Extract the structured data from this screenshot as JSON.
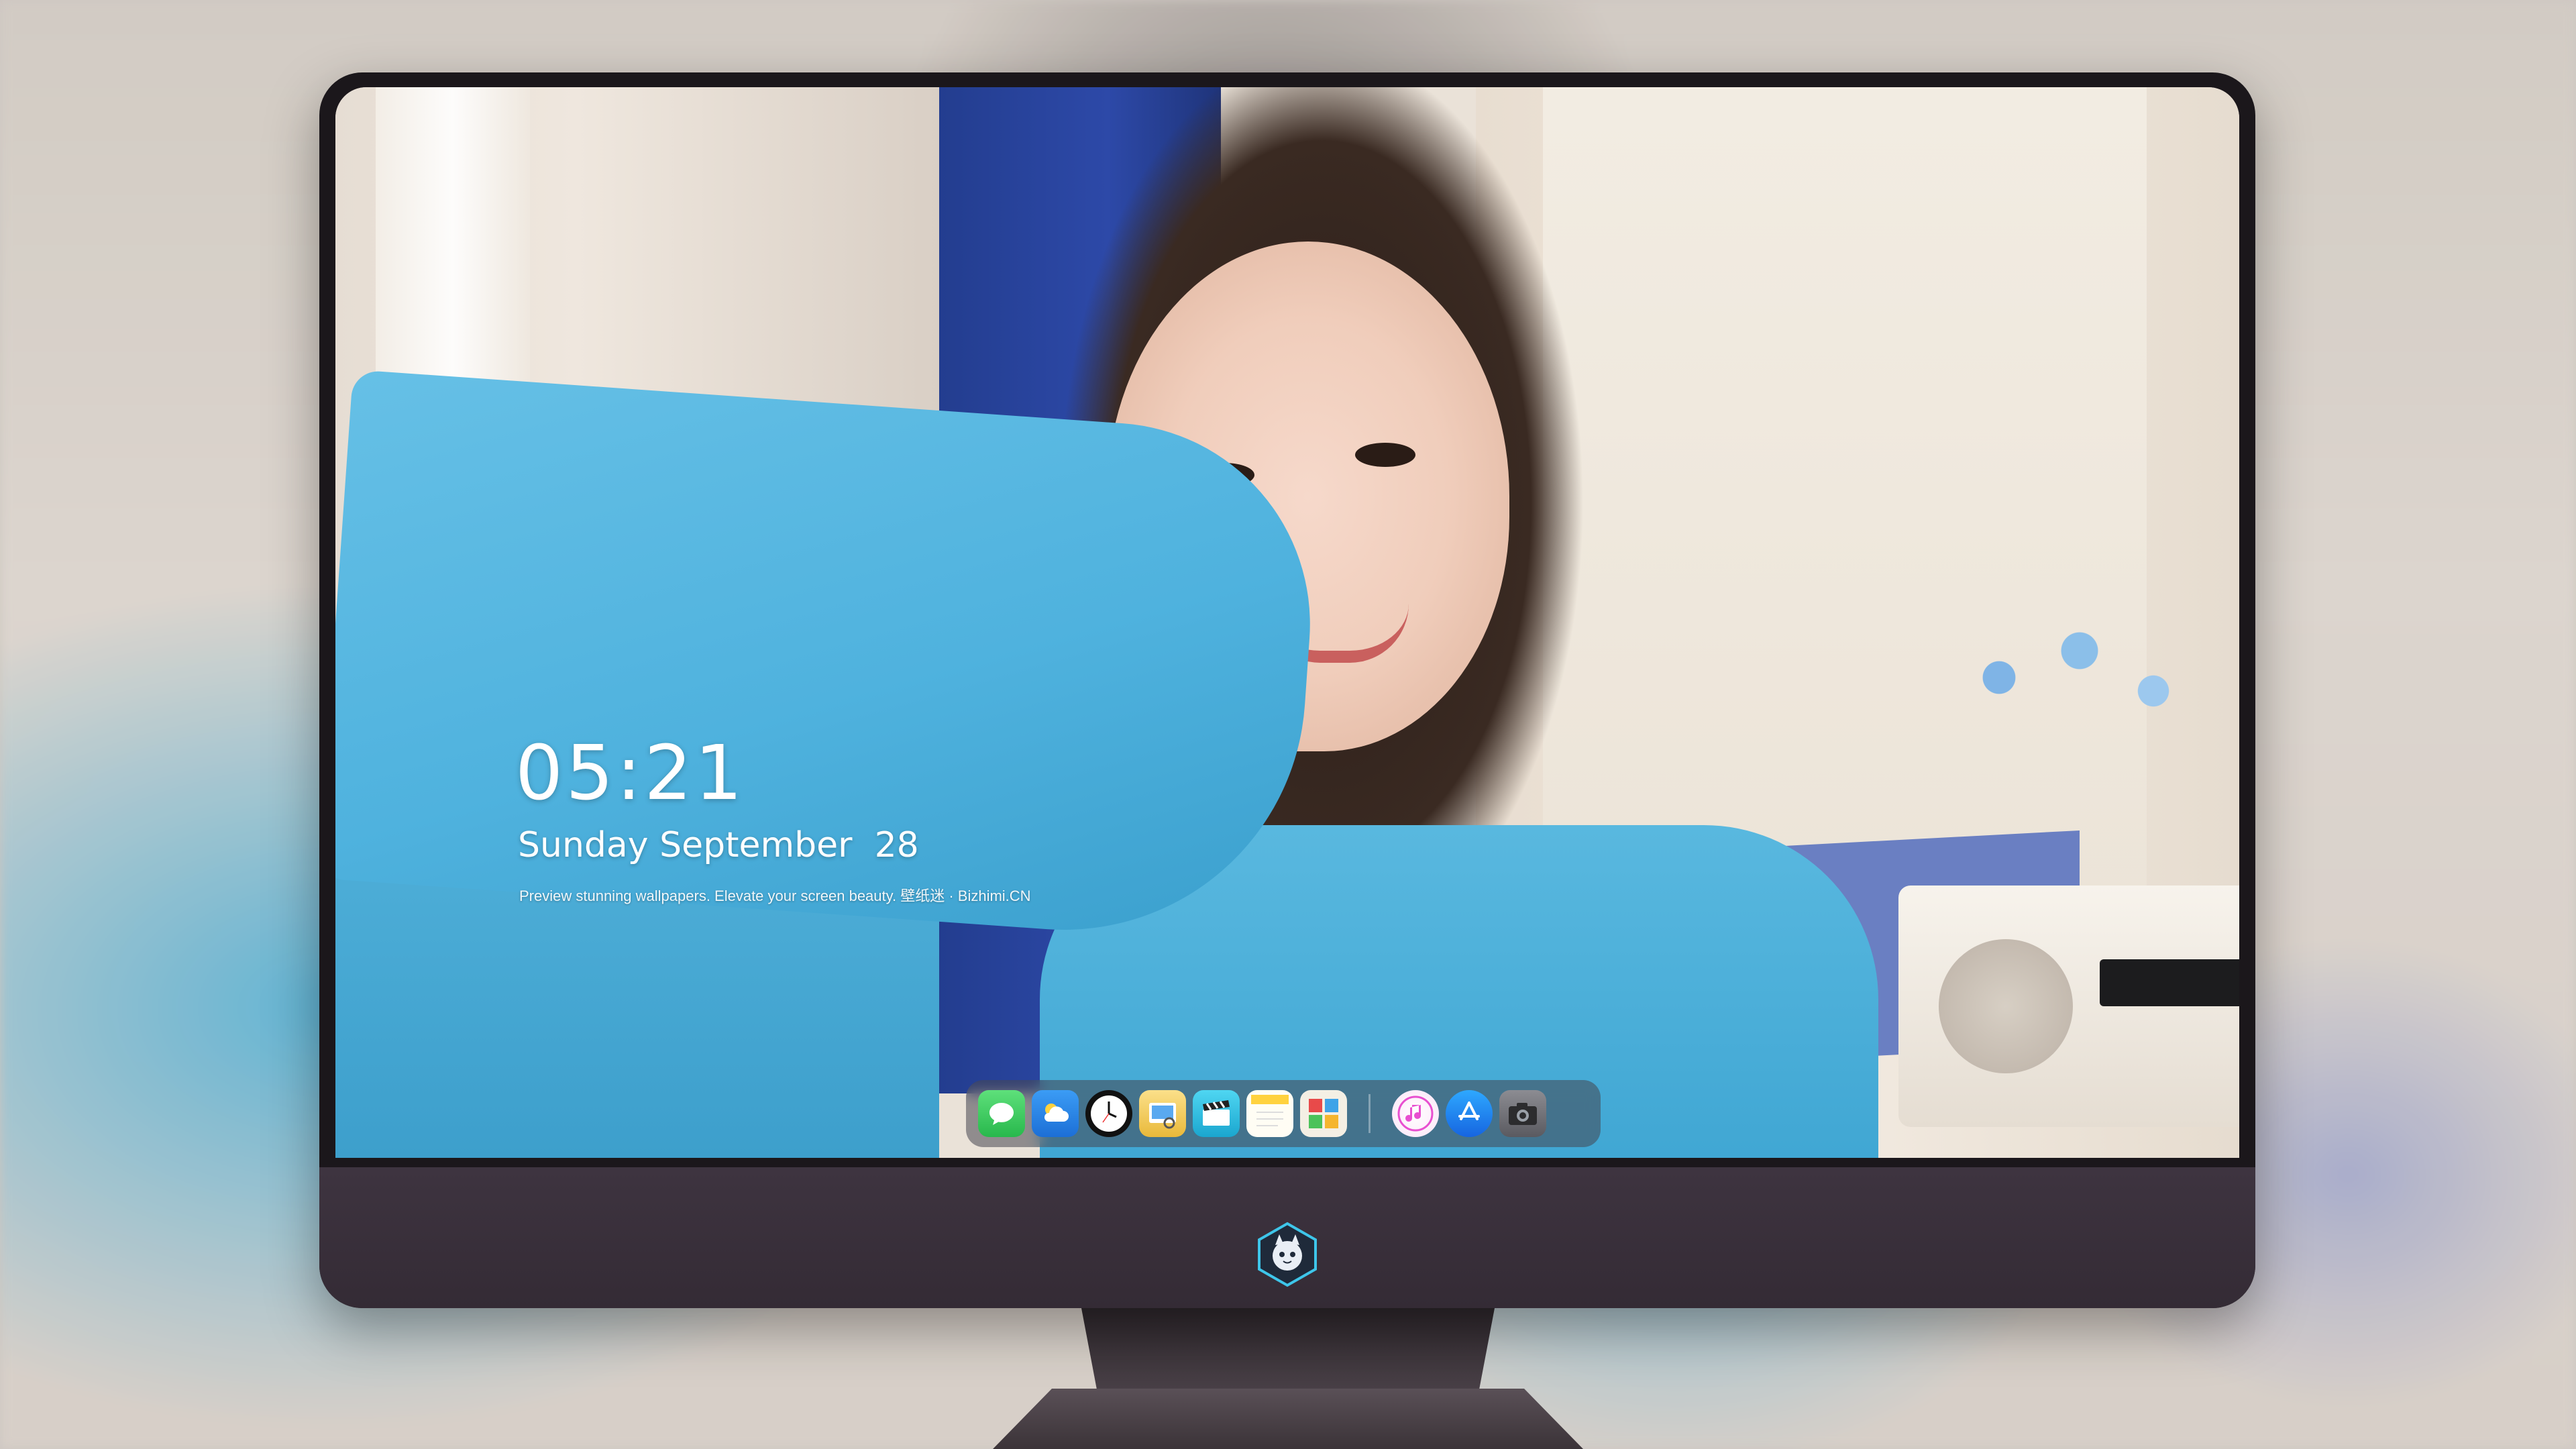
{
  "lockscreen": {
    "time": "05:21",
    "date": "Sunday September  28",
    "tagline": "Preview stunning wallpapers. Elevate your screen beauty. 壁纸迷 · Bizhimi.CN"
  },
  "dock": {
    "apps": [
      {
        "name": "messages",
        "icon": "message-bubble-icon",
        "color": "#34c759"
      },
      {
        "name": "weather",
        "icon": "cloud-sun-icon",
        "color": "#2f8cf0"
      },
      {
        "name": "clock",
        "icon": "clock-icon",
        "color": "#ffffff"
      },
      {
        "name": "preview",
        "icon": "photo-viewer-icon",
        "color": "#f5c542"
      },
      {
        "name": "clips",
        "icon": "clapperboard-icon",
        "color": "#36c3e8"
      },
      {
        "name": "notes",
        "icon": "notes-icon",
        "color": "#ffd84a"
      },
      {
        "name": "photo-booth",
        "icon": "photo-booth-icon",
        "color": "#f5f0e6"
      },
      {
        "name": "itunes",
        "icon": "music-note-icon",
        "color": "#e84fd0"
      },
      {
        "name": "app-store",
        "icon": "app-store-icon",
        "color": "#1e90ff"
      },
      {
        "name": "camera",
        "icon": "camera-icon",
        "color": "#6d6d72"
      }
    ]
  },
  "colors": {
    "monitor_bezel": "#1b171b",
    "monitor_chin": "#3a303b",
    "sweater": "#4fb2de"
  }
}
